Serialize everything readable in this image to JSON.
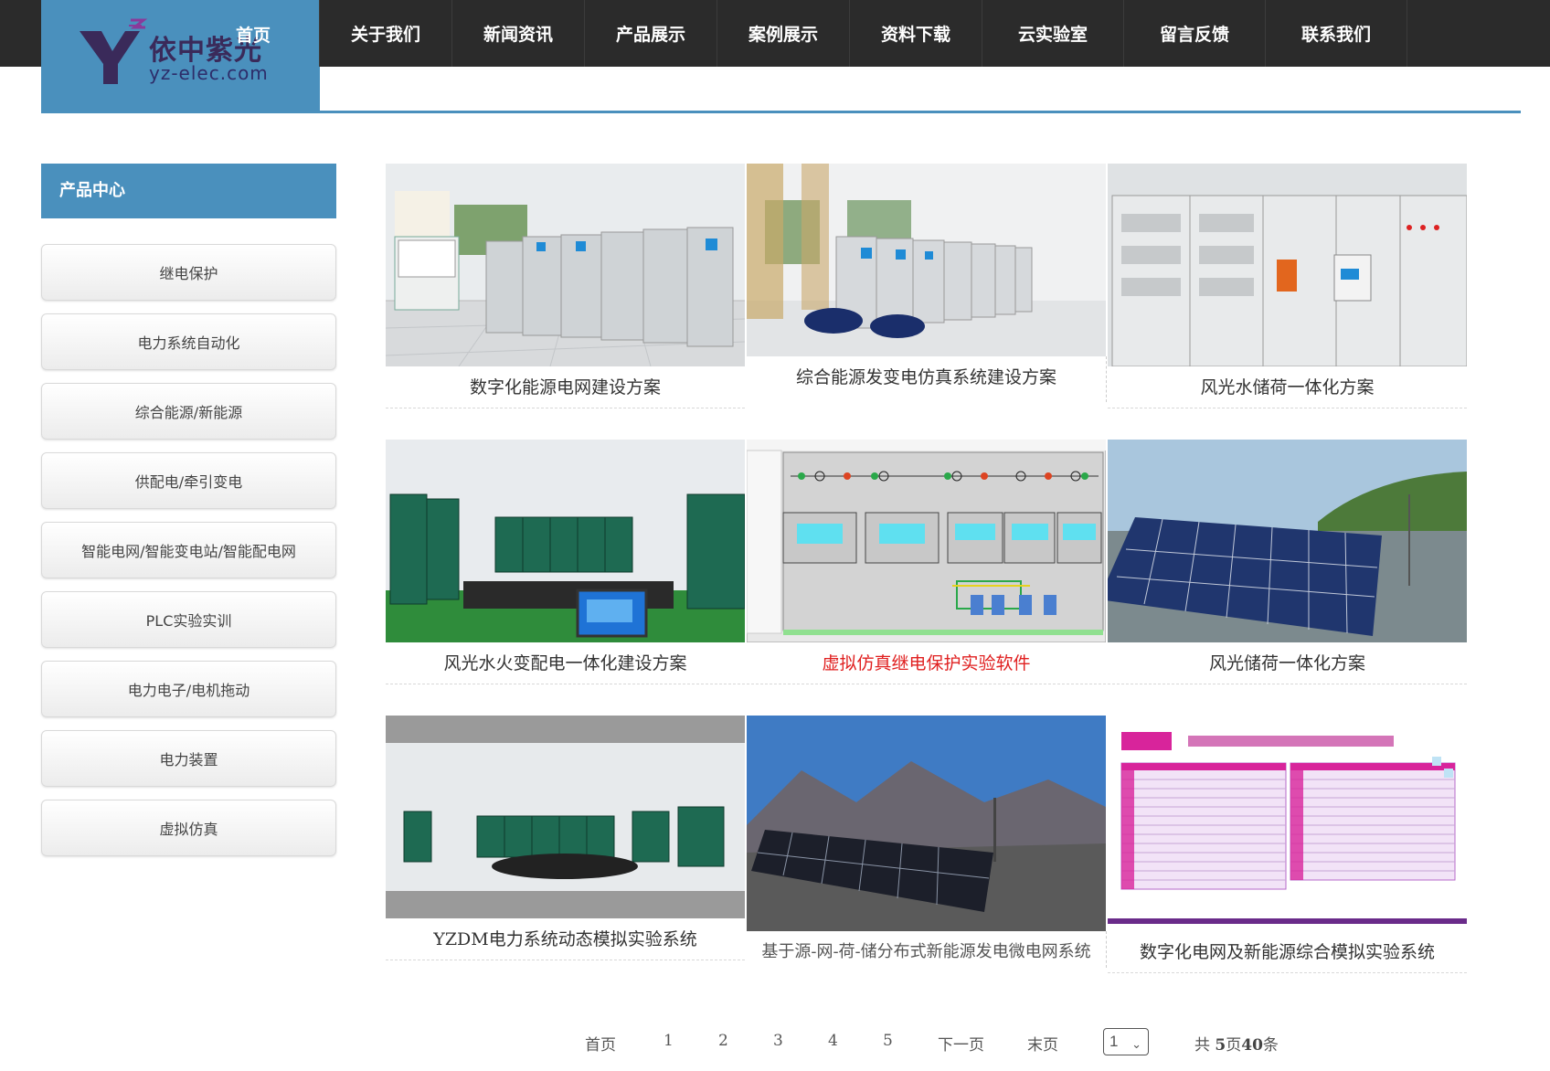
{
  "brand": {
    "name_cn": "依中紫光",
    "domain": "yz-elec.com"
  },
  "nav": {
    "items": [
      "首页",
      "关于我们",
      "新闻资讯",
      "产品展示",
      "案例展示",
      "资料下载",
      "云实验室",
      "留言反馈",
      "联系我们"
    ]
  },
  "sidebar": {
    "title": "产品中心",
    "items": [
      "继电保护",
      "电力系统自动化",
      "综合能源/新能源",
      "供配电/牵引变电",
      "智能电网/智能变电站/智能配电网",
      "PLC实验实训",
      "电力电子/电机拖动",
      "电力装置",
      "虚拟仿真"
    ]
  },
  "products": [
    {
      "caption": "数字化能源电网建设方案"
    },
    {
      "caption": "综合能源发变电仿真系统建设方案"
    },
    {
      "caption": "风光水储荷一体化方案"
    },
    {
      "caption": "风光水火变配电一体化建设方案"
    },
    {
      "caption": "虚拟仿真继电保护实验软件",
      "highlight": true
    },
    {
      "caption": "风光储荷一体化方案"
    },
    {
      "caption": "YZDM电力系统动态模拟实验系统"
    },
    {
      "caption": "基于源-网-荷-储分布式新能源发电微电网系统"
    },
    {
      "caption": "数字化电网及新能源综合模拟实验系统"
    }
  ],
  "pagination": {
    "first": "首页",
    "pages": [
      "1",
      "2",
      "3",
      "4",
      "5"
    ],
    "next": "下一页",
    "last": "末页",
    "selected": "1",
    "total_prefix": "共",
    "total_pages": "5",
    "pages_unit": "页",
    "total_items": "40",
    "items_unit": "条"
  },
  "colors": {
    "accent": "#4a90bd",
    "nav_bg": "#2b2b2b",
    "highlight": "#e02020"
  }
}
